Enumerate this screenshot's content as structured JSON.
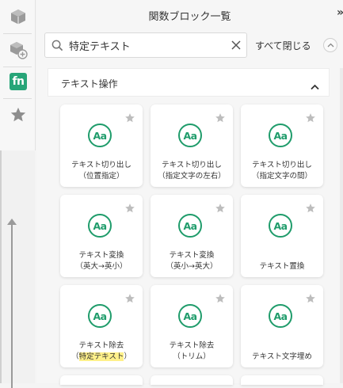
{
  "panel": {
    "title": "関数ブロック一覧",
    "collapse_label": "»"
  },
  "search": {
    "value": "特定テキスト",
    "placeholder": "検索"
  },
  "close_all_label": "すべて閉じる",
  "section": {
    "label": "テキスト操作"
  },
  "cards": [
    {
      "line1": "テキスト切り出し",
      "line2": "（位置指定）"
    },
    {
      "line1": "テキスト切り出し",
      "line2": "（指定文字の左右）"
    },
    {
      "line1": "テキスト切り出し",
      "line2": "（指定文字の間）"
    },
    {
      "line1": "テキスト変換",
      "line2": "（英大→英小）"
    },
    {
      "line1": "テキスト変換",
      "line2": "（英小→英大）"
    },
    {
      "line1": "テキスト置換",
      "line2": ""
    },
    {
      "line1": "テキスト除去",
      "line2_pre": "（",
      "line2_highlight": "特定テキスト",
      "line2_post": "）"
    },
    {
      "line1": "テキスト除去",
      "line2": "（トリム）"
    },
    {
      "line1": "テキスト文字埋め",
      "line2": ""
    }
  ],
  "card_icon_text": "Aa",
  "rail": {
    "fn_label": "fn"
  },
  "colors": {
    "accent_green": "#1f9c6b",
    "highlight": "#fff08a"
  }
}
